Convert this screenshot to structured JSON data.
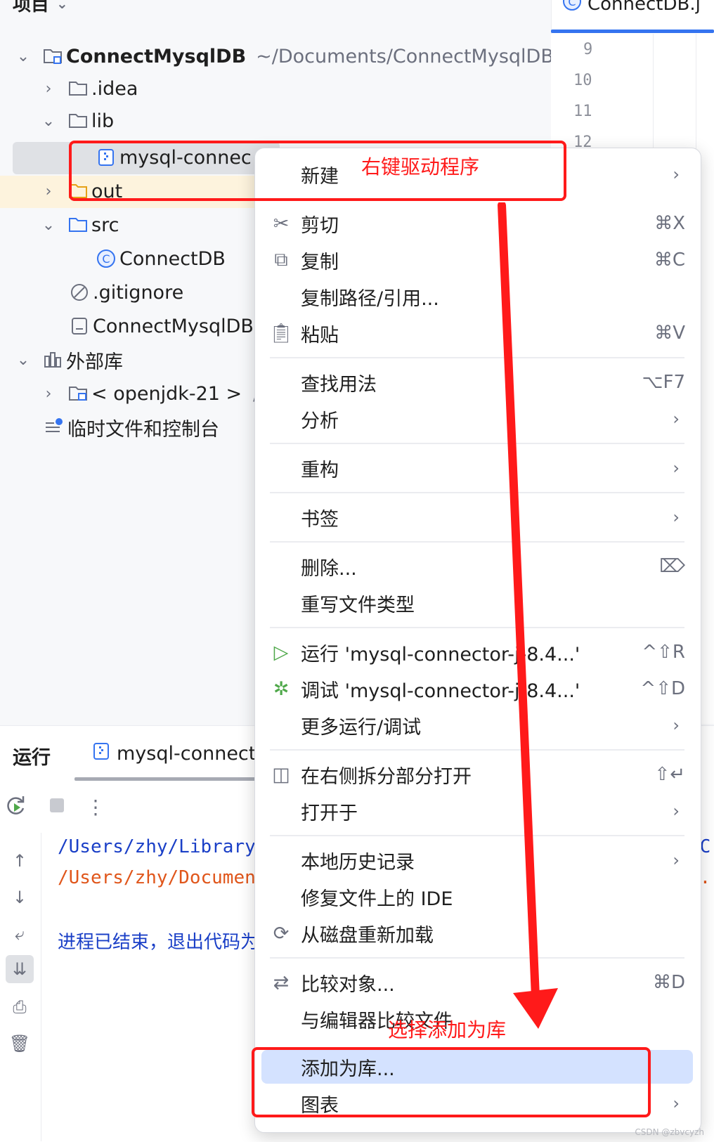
{
  "project": {
    "header_title": "项目",
    "root": {
      "name": "ConnectMysqlDB",
      "path": "~/Documents/ConnectMysqlDB"
    },
    "items": {
      "idea": ".idea",
      "lib": "lib",
      "jar": "mysql-connec",
      "out": "out",
      "src": "src",
      "connectdb": "ConnectDB",
      "gitignore": ".gitignore",
      "iml": "ConnectMysqlDB",
      "external_libs": "外部库",
      "jdk": "< openjdk-21 >",
      "jdk_suffix": "/",
      "scratches": "临时文件和控制台"
    }
  },
  "editor": {
    "tab_label": "ConnectDB.j",
    "line_numbers": [
      "9",
      "10",
      "11",
      "12"
    ]
  },
  "run_panel": {
    "title": "运行",
    "tab_label": "mysql-connect",
    "console": {
      "line1": "/Users/zhy/Library",
      "line2": "/Users/zhy/Documen",
      "line3": "进程已结束，退出代码为",
      "right1": "/C",
      "right2": "3."
    }
  },
  "context_menu": {
    "new": "新建",
    "cut": "剪切",
    "cut_sc": "⌘X",
    "copy": "复制",
    "copy_sc": "⌘C",
    "copy_path": "复制路径/引用...",
    "paste": "粘贴",
    "paste_sc": "⌘V",
    "find_usages": "查找用法",
    "find_usages_sc": "⌥F7",
    "analyze": "分析",
    "refactor": "重构",
    "bookmarks": "书签",
    "delete": "删除...",
    "override_type": "重写文件类型",
    "run": "运行 'mysql-connector-j-8.4...'",
    "run_sc": "^⇧R",
    "debug": "调试 'mysql-connector-j-8.4...'",
    "debug_sc": "^⇧D",
    "more_run": "更多运行/调试",
    "split_open": "在右侧拆分部分打开",
    "split_sc": "⇧↵",
    "open_in": "打开于",
    "local_history": "本地历史记录",
    "repair_ide": "修复文件上的 IDE",
    "reload": "从磁盘重新加载",
    "compare": "比较对象...",
    "compare_sc": "⌘D",
    "compare_editor": "与编辑器比较文件",
    "add_as_library": "添加为库...",
    "diagrams": "图表"
  },
  "annotations": {
    "top_note": "右键驱动程序",
    "bottom_note": "选择添加为库"
  },
  "watermark": "CSDN @zbvcyzh",
  "colors": {
    "accent": "#3574f0",
    "highlight": "#d4e2ff",
    "annotation": "#ff1a1a"
  }
}
